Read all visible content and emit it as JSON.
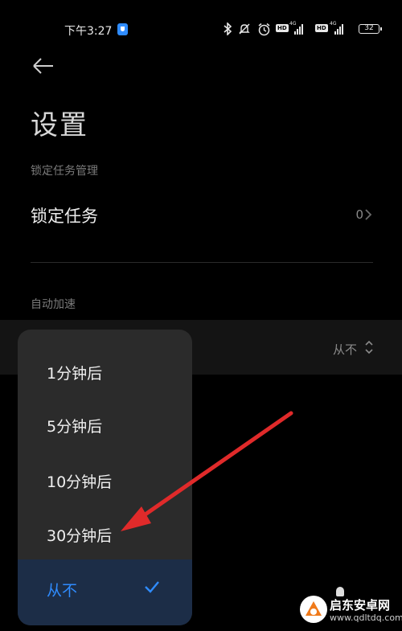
{
  "status_bar": {
    "time": "下午3:27",
    "icons": [
      "shield-icon",
      "bluetooth-icon",
      "mute-icon",
      "alarm-icon",
      "hd-icon",
      "signal-icon",
      "hd-icon",
      "signal-icon",
      "battery-icon"
    ],
    "hd_label": "HD",
    "network_label": "4G",
    "battery_level": "32"
  },
  "header": {
    "back_icon": "back-arrow-icon",
    "title": "设置"
  },
  "lock_section": {
    "label": "锁定任务管理",
    "row_label": "锁定任务",
    "row_value": "0"
  },
  "accel_section": {
    "label": "自动加速",
    "current_value": "从不"
  },
  "dropdown": {
    "options": [
      {
        "label": "1分钟后",
        "selected": false
      },
      {
        "label": "5分钟后",
        "selected": false
      },
      {
        "label": "10分钟后",
        "selected": false
      },
      {
        "label": "30分钟后",
        "selected": false
      },
      {
        "label": "从不",
        "selected": true
      }
    ]
  },
  "annotation": {
    "icon": "red-pointer-arrow-icon",
    "color": "#e02a2a"
  },
  "watermark": {
    "title": "启东安卓网",
    "url": "www.qdltdq.com"
  },
  "colors": {
    "background": "#000000",
    "accent": "#2f8cff",
    "popup": "#2b2b2b",
    "selected_row": "#1c2d47"
  }
}
